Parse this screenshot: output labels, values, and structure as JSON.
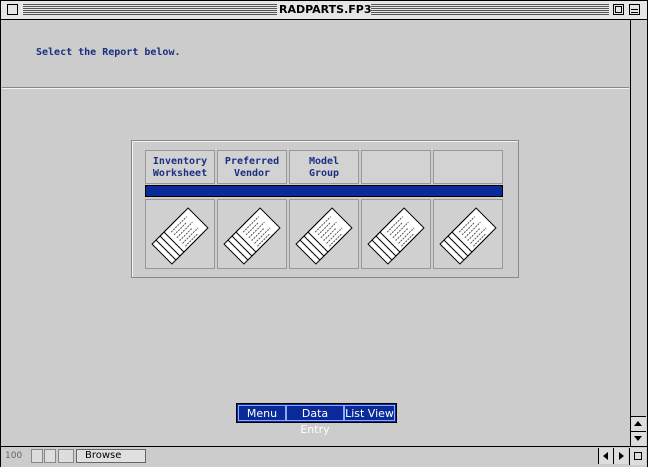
{
  "window": {
    "title": "RADPARTS.FP3"
  },
  "header": {
    "instruction": "Select the Report below."
  },
  "reports": [
    {
      "label": "Inventory\nWorksheet"
    },
    {
      "label": "Preferred\nVendor"
    },
    {
      "label": "Model\nGroup"
    },
    {
      "label": ""
    },
    {
      "label": ""
    }
  ],
  "nav": {
    "menu": "Menu",
    "data_entry": "Data Entry",
    "list_view": "List View"
  },
  "status": {
    "zoom_level": "100",
    "mode": "Browse"
  },
  "colors": {
    "accent": "#0a2a9a",
    "text_blue": "#1a2f80",
    "background": "#cccccc"
  },
  "icons": {
    "report_button": "report-pages-icon"
  }
}
